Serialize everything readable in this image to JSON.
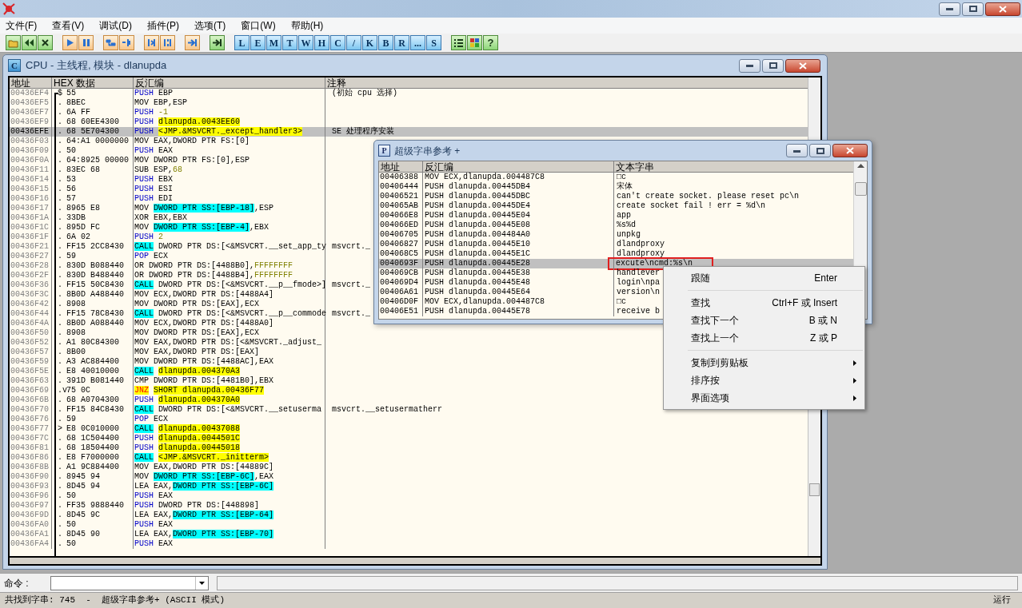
{
  "menu": [
    "文件(F)",
    "查看(V)",
    "调试(D)",
    "插件(P)",
    "选项(T)",
    "窗口(W)",
    "帮助(H)"
  ],
  "toolbar_keys": [
    "L",
    "E",
    "M",
    "T",
    "W",
    "H",
    "C",
    "/",
    "K",
    "B",
    "R",
    "...",
    "S"
  ],
  "help_key": "?",
  "cpu": {
    "icon_letter": "C",
    "title": "CPU - 主线程, 模块 - dlanupda",
    "columns": [
      "地址",
      "HEX 数据",
      "反汇编",
      "注释"
    ],
    "rows": [
      {
        "address": "00436EF4",
        "mark": "$",
        "hex": "55",
        "op": {
          "text": "PUSH",
          "kind": "stack"
        },
        "operands": [
          {
            "text": "EBP",
            "kind": "plain"
          }
        ],
        "comment": "(初始 cpu 选择)",
        "selected": false
      },
      {
        "address": "00436EF5",
        "mark": ".",
        "hex": "8BEC",
        "op": {
          "text": "MOV",
          "kind": "plain"
        },
        "operands": [
          {
            "text": "EBP,ESP",
            "kind": "plain"
          }
        ],
        "selected": false
      },
      {
        "address": "00436EF7",
        "mark": ".",
        "hex": "6A FF",
        "op": {
          "text": "PUSH",
          "kind": "stack"
        },
        "operands": [
          {
            "text": "-1",
            "kind": "const"
          }
        ],
        "selected": false
      },
      {
        "address": "00436EF9",
        "mark": ".",
        "hex": "68 60EE4300",
        "op": {
          "text": "PUSH",
          "kind": "stack"
        },
        "operands": [
          {
            "text": "dlanupda.0043EE60",
            "kind": "yellow"
          }
        ],
        "selected": false
      },
      {
        "address": "00436EFE",
        "mark": ".",
        "hex": "68 5E704300",
        "op": {
          "text": "PUSH",
          "kind": "stack"
        },
        "operands": [
          {
            "text": "<JMP.&MSVCRT._except_handler3>",
            "kind": "yellow"
          }
        ],
        "comment": "SE 处理程序安装",
        "selected": true
      },
      {
        "address": "00436F03",
        "mark": ".",
        "hex": "64:A1 0000000",
        "op": {
          "text": "MOV",
          "kind": "plain"
        },
        "operands": [
          {
            "text": "EAX,DWORD PTR FS:[0]",
            "kind": "plain"
          }
        ],
        "selected": false
      },
      {
        "address": "00436F09",
        "mark": ".",
        "hex": "50",
        "op": {
          "text": "PUSH",
          "kind": "stack"
        },
        "operands": [
          {
            "text": "EAX",
            "kind": "plain"
          }
        ],
        "selected": false
      },
      {
        "address": "00436F0A",
        "mark": ".",
        "hex": "64:8925 00000",
        "op": {
          "text": "MOV",
          "kind": "plain"
        },
        "operands": [
          {
            "text": "DWORD PTR FS:[0],ESP",
            "kind": "plain"
          }
        ],
        "selected": false
      },
      {
        "address": "00436F11",
        "mark": ".",
        "hex": "83EC 68",
        "op": {
          "text": "SUB",
          "kind": "plain"
        },
        "operands": [
          {
            "text": "ESP,",
            "kind": "plain"
          },
          {
            "text": "68",
            "kind": "const"
          }
        ],
        "selected": false
      },
      {
        "address": "00436F14",
        "mark": ".",
        "hex": "53",
        "op": {
          "text": "PUSH",
          "kind": "stack"
        },
        "operands": [
          {
            "text": "EBX",
            "kind": "plain"
          }
        ],
        "selected": false
      },
      {
        "address": "00436F15",
        "mark": ".",
        "hex": "56",
        "op": {
          "text": "PUSH",
          "kind": "stack"
        },
        "operands": [
          {
            "text": "ESI",
            "kind": "plain"
          }
        ],
        "selected": false
      },
      {
        "address": "00436F16",
        "mark": ".",
        "hex": "57",
        "op": {
          "text": "PUSH",
          "kind": "stack"
        },
        "operands": [
          {
            "text": "EDI",
            "kind": "plain"
          }
        ],
        "selected": false
      },
      {
        "address": "00436F17",
        "mark": ".",
        "hex": "8965 E8",
        "op": {
          "text": "MOV",
          "kind": "plain"
        },
        "operands": [
          {
            "text": "DWORD PTR SS:[EBP-18]",
            "kind": "cyan"
          },
          {
            "text": ",ESP",
            "kind": "plain"
          }
        ],
        "selected": false
      },
      {
        "address": "00436F1A",
        "mark": ".",
        "hex": "33DB",
        "op": {
          "text": "XOR",
          "kind": "plain"
        },
        "operands": [
          {
            "text": "EBX,EBX",
            "kind": "plain"
          }
        ],
        "selected": false
      },
      {
        "address": "00436F1C",
        "mark": ".",
        "hex": "895D FC",
        "op": {
          "text": "MOV",
          "kind": "plain"
        },
        "operands": [
          {
            "text": "DWORD PTR SS:[EBP-4]",
            "kind": "cyan"
          },
          {
            "text": ",EBX",
            "kind": "plain"
          }
        ],
        "selected": false
      },
      {
        "address": "00436F1F",
        "mark": ".",
        "hex": "6A 02",
        "op": {
          "text": "PUSH",
          "kind": "stack"
        },
        "operands": [
          {
            "text": "2",
            "kind": "const"
          }
        ],
        "selected": false
      },
      {
        "address": "00436F21",
        "mark": ".",
        "hex": "FF15 2CC8430",
        "op": {
          "text": "CALL",
          "kind": "call"
        },
        "operands": [
          {
            "text": "DWORD PTR DS:[<&MSVCRT.__set_app_ty",
            "kind": "plain"
          }
        ],
        "comment": "msvcrt._",
        "selected": false
      },
      {
        "address": "00436F27",
        "mark": ".",
        "hex": "59",
        "op": {
          "text": "POP",
          "kind": "stack"
        },
        "operands": [
          {
            "text": "ECX",
            "kind": "plain"
          }
        ],
        "selected": false
      },
      {
        "address": "00436F28",
        "mark": ".",
        "hex": "830D B088440",
        "op": {
          "text": "OR",
          "kind": "plain"
        },
        "operands": [
          {
            "text": "DWORD PTR DS:[4488B0],",
            "kind": "plain"
          },
          {
            "text": "FFFFFFFF",
            "kind": "const"
          }
        ],
        "selected": false
      },
      {
        "address": "00436F2F",
        "mark": ".",
        "hex": "830D B488440",
        "op": {
          "text": "OR",
          "kind": "plain"
        },
        "operands": [
          {
            "text": "DWORD PTR DS:[4488B4],",
            "kind": "plain"
          },
          {
            "text": "FFFFFFFF",
            "kind": "const"
          }
        ],
        "selected": false
      },
      {
        "address": "00436F36",
        "mark": ".",
        "hex": "FF15 50C8430",
        "op": {
          "text": "CALL",
          "kind": "call"
        },
        "operands": [
          {
            "text": "DWORD PTR DS:[<&MSVCRT.__p__fmode>]",
            "kind": "plain"
          }
        ],
        "comment": "msvcrt._",
        "selected": false
      },
      {
        "address": "00436F3C",
        "mark": ".",
        "hex": "8B0D A488440",
        "op": {
          "text": "MOV",
          "kind": "plain"
        },
        "operands": [
          {
            "text": "ECX,DWORD PTR DS:[4488A4]",
            "kind": "plain"
          }
        ],
        "selected": false
      },
      {
        "address": "00436F42",
        "mark": ".",
        "hex": "8908",
        "op": {
          "text": "MOV",
          "kind": "plain"
        },
        "operands": [
          {
            "text": "DWORD PTR DS:[EAX],ECX",
            "kind": "plain"
          }
        ],
        "selected": false
      },
      {
        "address": "00436F44",
        "mark": ".",
        "hex": "FF15 78C8430",
        "op": {
          "text": "CALL",
          "kind": "call"
        },
        "operands": [
          {
            "text": "DWORD PTR DS:[<&MSVCRT.__p__commode",
            "kind": "plain"
          }
        ],
        "comment": "msvcrt._",
        "selected": false
      },
      {
        "address": "00436F4A",
        "mark": ".",
        "hex": "8B0D A088440",
        "op": {
          "text": "MOV",
          "kind": "plain"
        },
        "operands": [
          {
            "text": "ECX,DWORD PTR DS:[4488A0]",
            "kind": "plain"
          }
        ],
        "selected": false
      },
      {
        "address": "00436F50",
        "mark": ".",
        "hex": "8908",
        "op": {
          "text": "MOV",
          "kind": "plain"
        },
        "operands": [
          {
            "text": "DWORD PTR DS:[EAX],ECX",
            "kind": "plain"
          }
        ],
        "selected": false
      },
      {
        "address": "00436F52",
        "mark": ".",
        "hex": "A1 80C84300",
        "op": {
          "text": "MOV",
          "kind": "plain"
        },
        "operands": [
          {
            "text": "EAX,DWORD PTR DS:[<&MSVCRT._adjust_",
            "kind": "plain"
          }
        ],
        "selected": false
      },
      {
        "address": "00436F57",
        "mark": ".",
        "hex": "8B00",
        "op": {
          "text": "MOV",
          "kind": "plain"
        },
        "operands": [
          {
            "text": "EAX,DWORD PTR DS:[EAX]",
            "kind": "plain"
          }
        ],
        "selected": false
      },
      {
        "address": "00436F59",
        "mark": ".",
        "hex": "A3 AC884400",
        "op": {
          "text": "MOV",
          "kind": "plain"
        },
        "operands": [
          {
            "text": "DWORD PTR DS:[4488AC],EAX",
            "kind": "plain"
          }
        ],
        "selected": false
      },
      {
        "address": "00436F5E",
        "mark": ".",
        "hex": "E8 40010000",
        "op": {
          "text": "CALL",
          "kind": "call"
        },
        "operands": [
          {
            "text": "dlanupda.004370A3",
            "kind": "yellow"
          }
        ],
        "selected": false
      },
      {
        "address": "00436F63",
        "mark": ".",
        "hex": "391D B081440",
        "op": {
          "text": "CMP",
          "kind": "plain"
        },
        "operands": [
          {
            "text": "DWORD PTR DS:[4481B0],EBX",
            "kind": "plain"
          }
        ],
        "selected": false
      },
      {
        "address": "00436F69",
        "mark": ".v",
        "hex": "75 0C",
        "op": {
          "text": "JNZ",
          "kind": "jump"
        },
        "operands": [
          {
            "text": "SHORT dlanupda.00436F77",
            "kind": "yellow"
          }
        ],
        "selected": false
      },
      {
        "address": "00436F6B",
        "mark": ".",
        "hex": "68 A0704300",
        "op": {
          "text": "PUSH",
          "kind": "stack"
        },
        "operands": [
          {
            "text": "dlanupda.004370A0",
            "kind": "yellow"
          }
        ],
        "selected": false
      },
      {
        "address": "00436F70",
        "mark": ".",
        "hex": "FF15 84C8430",
        "op": {
          "text": "CALL",
          "kind": "call"
        },
        "operands": [
          {
            "text": "DWORD PTR DS:[<&MSVCRT.__setuserma",
            "kind": "plain"
          }
        ],
        "comment": "msvcrt.__setusermatherr",
        "selected": false
      },
      {
        "address": "00436F76",
        "mark": ".",
        "hex": "59",
        "op": {
          "text": "POP",
          "kind": "stack"
        },
        "operands": [
          {
            "text": "ECX",
            "kind": "plain"
          }
        ],
        "selected": false
      },
      {
        "address": "00436F77",
        "mark": ">",
        "hex": "E8 0C010000",
        "op": {
          "text": "CALL",
          "kind": "call"
        },
        "operands": [
          {
            "text": "dlanupda.00437088",
            "kind": "yellow"
          }
        ],
        "selected": false
      },
      {
        "address": "00436F7C",
        "mark": ".",
        "hex": "68 1C504400",
        "op": {
          "text": "PUSH",
          "kind": "stack"
        },
        "operands": [
          {
            "text": "dlanupda.0044501C",
            "kind": "yellow"
          }
        ],
        "selected": false
      },
      {
        "address": "00436F81",
        "mark": ".",
        "hex": "68 18504400",
        "op": {
          "text": "PUSH",
          "kind": "stack"
        },
        "operands": [
          {
            "text": "dlanupda.00445018",
            "kind": "yellow"
          }
        ],
        "selected": false
      },
      {
        "address": "00436F86",
        "mark": ".",
        "hex": "E8 F7000000",
        "op": {
          "text": "CALL",
          "kind": "call"
        },
        "operands": [
          {
            "text": "<JMP.&MSVCRT._initterm>",
            "kind": "yellow"
          }
        ],
        "selected": false
      },
      {
        "address": "00436F8B",
        "mark": ".",
        "hex": "A1 9C884400",
        "op": {
          "text": "MOV",
          "kind": "plain"
        },
        "operands": [
          {
            "text": "EAX,DWORD PTR DS:[44889C]",
            "kind": "plain"
          }
        ],
        "selected": false
      },
      {
        "address": "00436F90",
        "mark": ".",
        "hex": "8945 94",
        "op": {
          "text": "MOV",
          "kind": "plain"
        },
        "operands": [
          {
            "text": "DWORD PTR SS:[EBP-6C]",
            "kind": "cyan"
          },
          {
            "text": ",EAX",
            "kind": "plain"
          }
        ],
        "selected": false
      },
      {
        "address": "00436F93",
        "mark": ".",
        "hex": "8D45 94",
        "op": {
          "text": "LEA",
          "kind": "plain"
        },
        "operands": [
          {
            "text": "EAX,",
            "kind": "plain"
          },
          {
            "text": "DWORD PTR SS:[EBP-6C]",
            "kind": "cyan"
          }
        ],
        "selected": false
      },
      {
        "address": "00436F96",
        "mark": ".",
        "hex": "50",
        "op": {
          "text": "PUSH",
          "kind": "stack"
        },
        "operands": [
          {
            "text": "EAX",
            "kind": "plain"
          }
        ],
        "selected": false
      },
      {
        "address": "00436F97",
        "mark": ".",
        "hex": "FF35 9888440",
        "op": {
          "text": "PUSH",
          "kind": "stack"
        },
        "operands": [
          {
            "text": "DWORD PTR DS:[448898]",
            "kind": "plain"
          }
        ],
        "selected": false
      },
      {
        "address": "00436F9D",
        "mark": ".",
        "hex": "8D45 9C",
        "op": {
          "text": "LEA",
          "kind": "plain"
        },
        "operands": [
          {
            "text": "EAX,",
            "kind": "plain"
          },
          {
            "text": "DWORD PTR SS:[EBP-64]",
            "kind": "cyan"
          }
        ],
        "selected": false
      },
      {
        "address": "00436FA0",
        "mark": ".",
        "hex": "50",
        "op": {
          "text": "PUSH",
          "kind": "stack"
        },
        "operands": [
          {
            "text": "EAX",
            "kind": "plain"
          }
        ],
        "selected": false
      },
      {
        "address": "00436FA1",
        "mark": ".",
        "hex": "8D45 90",
        "op": {
          "text": "LEA",
          "kind": "plain"
        },
        "operands": [
          {
            "text": "EAX,",
            "kind": "plain"
          },
          {
            "text": "DWORD PTR SS:[EBP-70]",
            "kind": "cyan"
          }
        ],
        "selected": false
      },
      {
        "address": "00436FA4",
        "mark": ".",
        "hex": "50",
        "op": {
          "text": "PUSH",
          "kind": "stack"
        },
        "operands": [
          {
            "text": "EAX",
            "kind": "plain"
          }
        ],
        "selected": false
      }
    ]
  },
  "strings": {
    "icon_letter": "P",
    "title": "超级字串参考 +",
    "columns": [
      "地址",
      "反汇编",
      "文本字串"
    ],
    "rows": [
      {
        "address": "00406388",
        "asm": "MOV ECX,dlanupda.004487C8",
        "text": "□c",
        "selected": false,
        "boxed": false
      },
      {
        "address": "00406444",
        "asm": "PUSH dlanupda.00445DB4",
        "text": "宋体",
        "selected": false,
        "boxed": false
      },
      {
        "address": "00406521",
        "asm": "PUSH dlanupda.00445DBC",
        "text": "can't create socket. please reset pc\\n",
        "selected": false,
        "boxed": false
      },
      {
        "address": "004065AB",
        "asm": "PUSH dlanupda.00445DE4",
        "text": "create socket fail ! err = %d\\n",
        "selected": false,
        "boxed": false
      },
      {
        "address": "004066E8",
        "asm": "PUSH dlanupda.00445E04",
        "text": "app",
        "selected": false,
        "boxed": false
      },
      {
        "address": "004066ED",
        "asm": "PUSH dlanupda.00445E08",
        "text": "%s%d",
        "selected": false,
        "boxed": false
      },
      {
        "address": "00406705",
        "asm": "PUSH dlanupda.004484A0",
        "text": "unpkg",
        "selected": false,
        "boxed": false
      },
      {
        "address": "00406827",
        "asm": "PUSH dlanupda.00445E10",
        "text": "dlandproxy",
        "selected": false,
        "boxed": false
      },
      {
        "address": "004068C5",
        "asm": "PUSH dlanupda.00445E1C",
        "text": "dlandproxy",
        "selected": false,
        "boxed": false
      },
      {
        "address": "0040693F",
        "asm": "PUSH dlanupda.00445E28",
        "text": "excute\\ncmd:%s\\n",
        "selected": true,
        "boxed": true
      },
      {
        "address": "004069CB",
        "asm": "PUSH dlanupda.00445E38",
        "text": "handlever",
        "selected": false,
        "boxed": false
      },
      {
        "address": "004069D4",
        "asm": "PUSH dlanupda.00445E48",
        "text": "login\\npa",
        "selected": false,
        "boxed": false
      },
      {
        "address": "00406A61",
        "asm": "PUSH dlanupda.00445E64",
        "text": "version\\n",
        "selected": false,
        "boxed": false
      },
      {
        "address": "00406D0F",
        "asm": "MOV ECX,dlanupda.004487C8",
        "text": "□c",
        "selected": false,
        "boxed": false
      },
      {
        "address": "00406E51",
        "asm": "PUSH dlanupda.00445E78",
        "text": "receive b",
        "selected": false,
        "boxed": false
      }
    ]
  },
  "context_menu": [
    {
      "kind": "item",
      "label": "跟随",
      "shortcut": "Enter"
    },
    {
      "kind": "separator"
    },
    {
      "kind": "item",
      "label": "查找",
      "shortcut": "Ctrl+F 或 Insert"
    },
    {
      "kind": "item",
      "label": "查找下一个",
      "shortcut": "B 或 N"
    },
    {
      "kind": "item",
      "label": "查找上一个",
      "shortcut": "Z 或 P"
    },
    {
      "kind": "separator"
    },
    {
      "kind": "submenu",
      "label": "复制到剪贴板"
    },
    {
      "kind": "submenu",
      "label": "排序按"
    },
    {
      "kind": "submenu",
      "label": "界面选项"
    }
  ],
  "command_label": "命令 :",
  "status": {
    "message": "共找到字串: 745  -  超级字串参考+ (ASCII 模式)",
    "state": "运行"
  }
}
